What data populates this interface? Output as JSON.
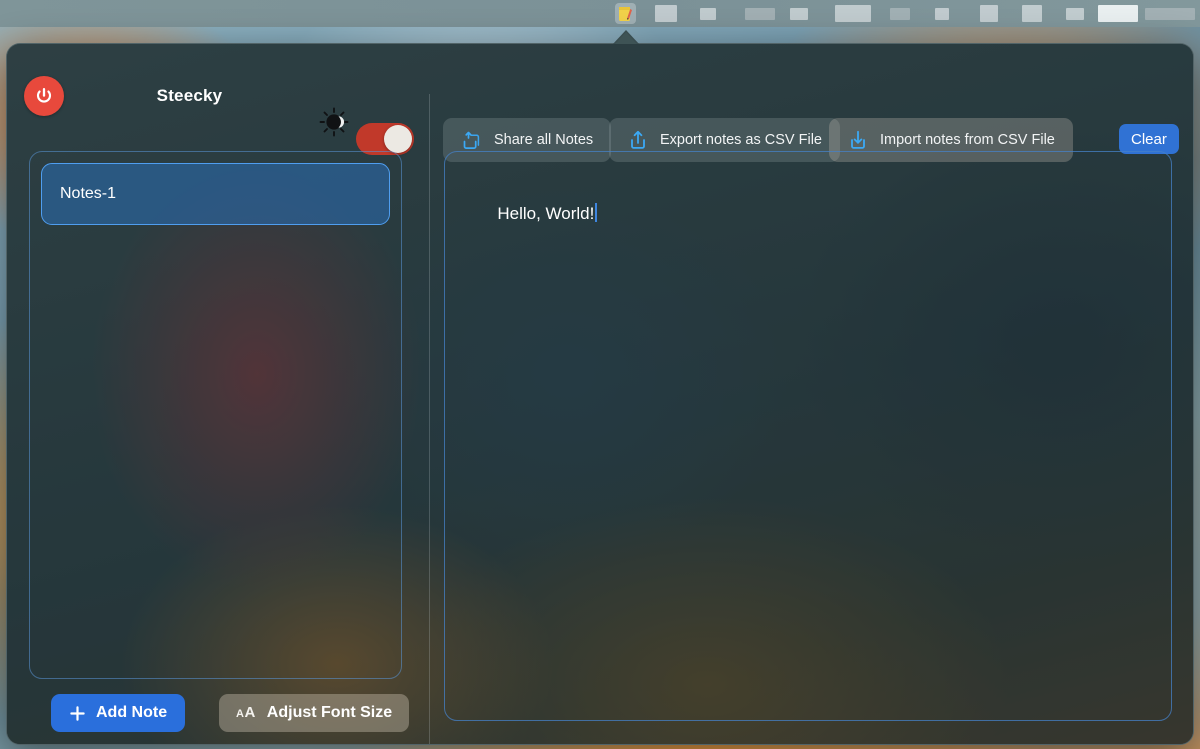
{
  "menubar": {
    "app_icon_name": "notes-app-menubar-icon"
  },
  "window": {
    "title": "Steecky"
  },
  "header": {
    "power_button_label": "",
    "power_icon": "power-icon",
    "darkmode_icon": "sun-moon-icon",
    "darkmode_toggle_state": "on",
    "toolbar": [
      {
        "label": "Share all Notes",
        "icon": "share-stack-icon"
      },
      {
        "label": "Export notes as CSV File",
        "icon": "share-up-arrow-icon"
      },
      {
        "label": "Import notes from CSV File",
        "icon": "import-down-arrow-icon"
      }
    ],
    "clear_label": "Clear"
  },
  "sidebar": {
    "notes": [
      {
        "title": "Notes-1",
        "selected": true
      }
    ],
    "add_note_label": "Add Note",
    "add_note_icon": "plus-icon",
    "font_size_label": "Adjust Font Size",
    "font_size_icon": "aa-icon"
  },
  "editor": {
    "content": "Hello, World!",
    "caret_visible": true
  },
  "colors": {
    "accent_blue": "#2a6fdc",
    "clear_blue": "#3072d4",
    "power_red": "#e8493c",
    "toggle_red": "#c1392a",
    "icon_cyan": "#3ba9f5",
    "selected_note_border": "#4f9ef0",
    "editor_border": "#4682c8",
    "caret_blue": "#3e86e0"
  }
}
